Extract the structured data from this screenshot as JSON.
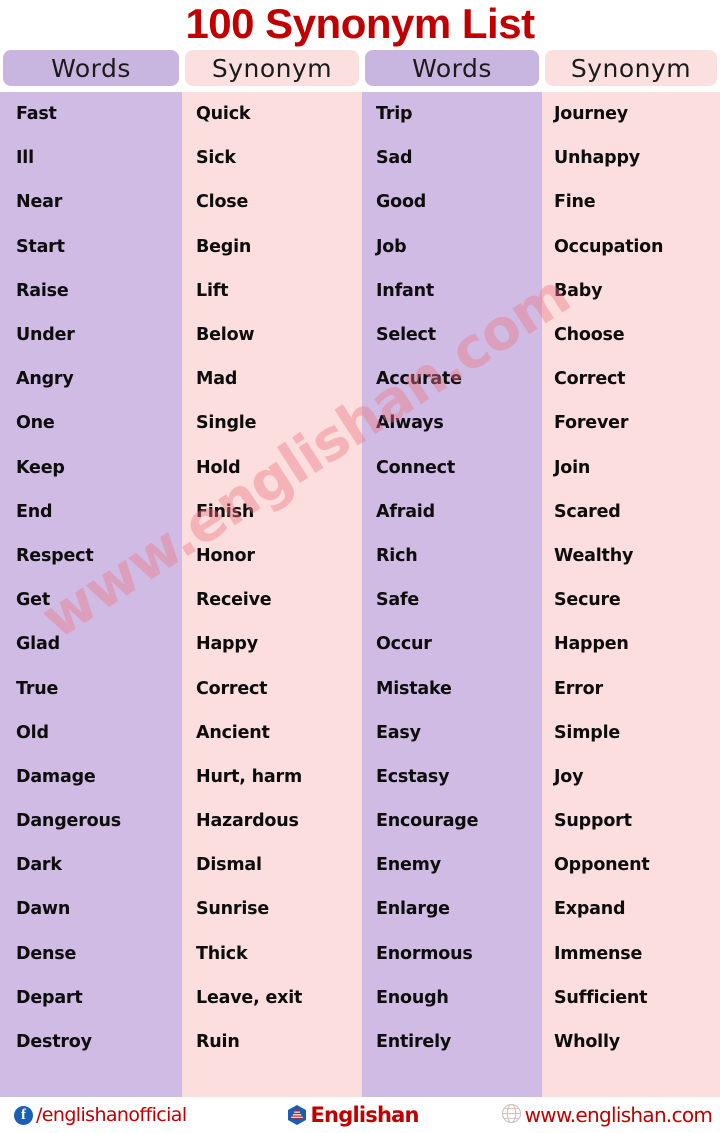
{
  "title": "100 Synonym List",
  "headers": [
    {
      "label": "Words",
      "name": "words-1"
    },
    {
      "label": "Synonym",
      "name": "synonym-1"
    },
    {
      "label": "Words",
      "name": "words-2"
    },
    {
      "label": "Synonym",
      "name": "synonym-2"
    }
  ],
  "colors": {
    "title": "#c00000",
    "words_column": "#cfbbe4",
    "synonym_column": "#fcdede",
    "header_words_pill": "#c9b6e0",
    "header_synonym_pill": "#fce0e0",
    "text": "#0d0d0d",
    "watermark": "#ec7882",
    "footer_text": "#c00000",
    "facebook_icon": "#1b5fb4"
  },
  "watermark": {
    "text": "www.englishan.com"
  },
  "table": {
    "left": [
      {
        "word": "Fast",
        "synonym": "Quick"
      },
      {
        "word": "Ill",
        "synonym": "Sick"
      },
      {
        "word": "Near",
        "synonym": "Close"
      },
      {
        "word": "Start",
        "synonym": "Begin"
      },
      {
        "word": "Raise",
        "synonym": "Lift"
      },
      {
        "word": "Under",
        "synonym": "Below"
      },
      {
        "word": "Angry",
        "synonym": "Mad"
      },
      {
        "word": "One",
        "synonym": "Single"
      },
      {
        "word": "Keep",
        "synonym": "Hold"
      },
      {
        "word": "End",
        "synonym": "Finish"
      },
      {
        "word": "Respect",
        "synonym": "Honor"
      },
      {
        "word": "Get",
        "synonym": "Receive"
      },
      {
        "word": "Glad",
        "synonym": "Happy"
      },
      {
        "word": "True",
        "synonym": "Correct"
      },
      {
        "word": "Old",
        "synonym": "Ancient"
      },
      {
        "word": "Damage",
        "synonym": "Hurt, harm"
      },
      {
        "word": "Dangerous",
        "synonym": "Hazardous"
      },
      {
        "word": "Dark",
        "synonym": "Dismal"
      },
      {
        "word": "Dawn",
        "synonym": "Sunrise"
      },
      {
        "word": "Dense",
        "synonym": "Thick"
      },
      {
        "word": "Depart",
        "synonym": "Leave, exit"
      },
      {
        "word": "Destroy",
        "synonym": "Ruin"
      }
    ],
    "right": [
      {
        "word": "Trip",
        "synonym": "Journey"
      },
      {
        "word": "Sad",
        "synonym": "Unhappy"
      },
      {
        "word": "Good",
        "synonym": "Fine"
      },
      {
        "word": "Job",
        "synonym": "Occupation"
      },
      {
        "word": "Infant",
        "synonym": "Baby"
      },
      {
        "word": "Select",
        "synonym": "Choose"
      },
      {
        "word": "Accurate",
        "synonym": "Correct"
      },
      {
        "word": "Always",
        "synonym": "Forever"
      },
      {
        "word": "Connect",
        "synonym": "Join"
      },
      {
        "word": "Afraid",
        "synonym": "Scared"
      },
      {
        "word": "Rich",
        "synonym": "Wealthy"
      },
      {
        "word": "Safe",
        "synonym": "Secure"
      },
      {
        "word": "Occur",
        "synonym": "Happen"
      },
      {
        "word": "Mistake",
        "synonym": "Error"
      },
      {
        "word": "Easy",
        "synonym": "Simple"
      },
      {
        "word": "Ecstasy",
        "synonym": "Joy"
      },
      {
        "word": "Encourage",
        "synonym": "Support"
      },
      {
        "word": "Enemy",
        "synonym": "Opponent"
      },
      {
        "word": "Enlarge",
        "synonym": "Expand"
      },
      {
        "word": "Enormous",
        "synonym": "Immense"
      },
      {
        "word": "Enough",
        "synonym": "Sufficient"
      },
      {
        "word": "Entirely",
        "synonym": "Wholly"
      }
    ]
  },
  "footer": {
    "facebook": {
      "icon": "facebook-icon",
      "handle": "/englishanofficial"
    },
    "brand": {
      "icon": "englishan-logo-icon",
      "name": "Englishan"
    },
    "website": {
      "icon": "globe-icon",
      "url": "www.englishan.com"
    }
  }
}
